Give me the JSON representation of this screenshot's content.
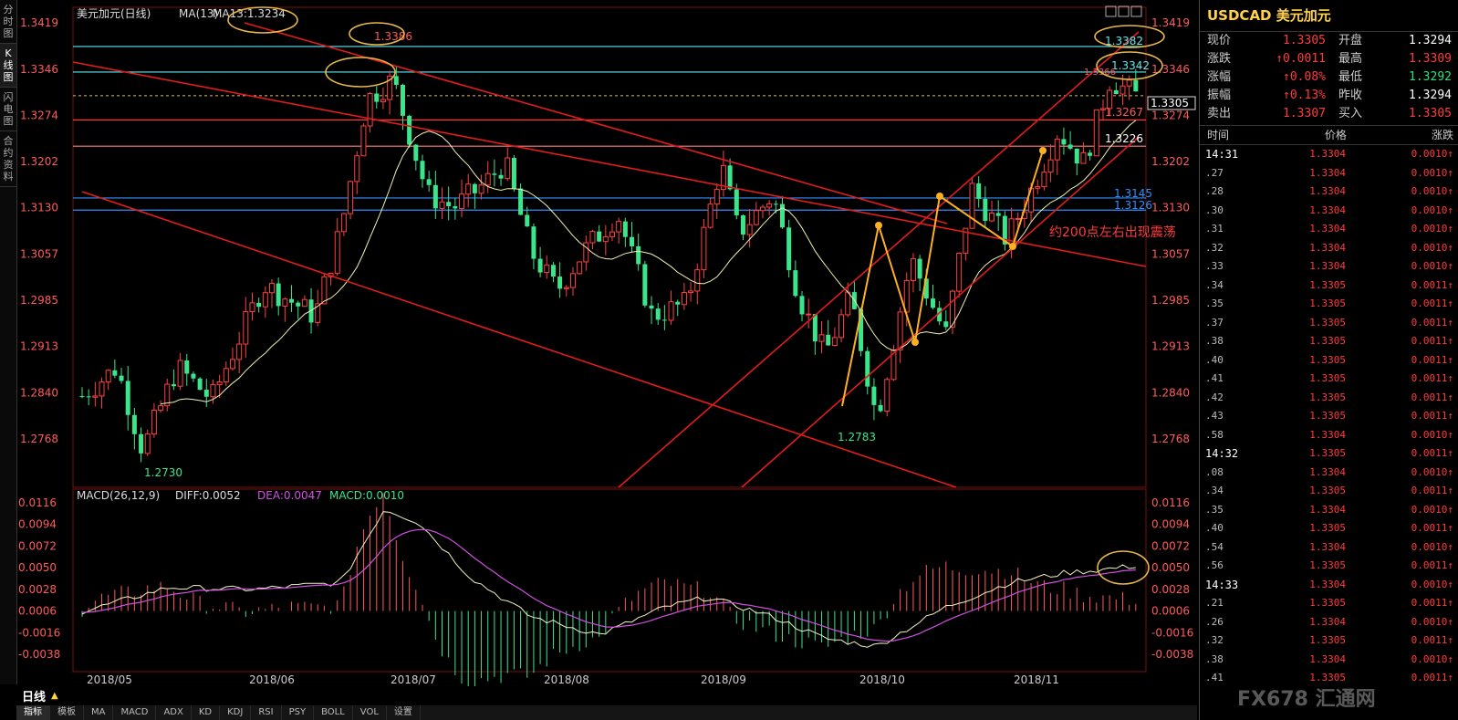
{
  "left_tabs": [
    "分时图",
    "K线图",
    "闪电图",
    "合约资料"
  ],
  "header": {
    "symbol_name": "美元加元(日线)",
    "ma_label": "MA(13)",
    "ma_value": "MA13:1.3234"
  },
  "price_axis": [
    "1.3419",
    "1.3346",
    "1.3274",
    "1.3202",
    "1.3130",
    "1.3057",
    "1.2985",
    "1.2913",
    "1.2840",
    "1.2768"
  ],
  "price_tags": {
    "current": "1.3305",
    "red_1": "1.3267",
    "red_2": "1.3226",
    "blue_1": "1.3145",
    "blue_2": "1.3126",
    "cyan_1": "1.3342",
    "cyan_2": "1.3382",
    "high_label": "1.3386",
    "low_label_1": "1.2730",
    "low_label_2": "1.2783",
    "top_small": "1.3366"
  },
  "annotation": "约200点左右出现震荡",
  "macd": {
    "label": "MACD(26,12,9)",
    "diff": "DIFF:0.0052",
    "dea": "DEA:0.0047",
    "macd": "MACD:0.0010",
    "axis": [
      "0.0116",
      "0.0094",
      "0.0072",
      "0.0050",
      "0.0028",
      "0.0006",
      "-0.0016",
      "-0.0038"
    ]
  },
  "time_axis": [
    "2018/05",
    "2018/06",
    "2018/07",
    "2018/08",
    "2018/09",
    "2018/10",
    "2018/11"
  ],
  "period": "日线",
  "tool_tabs": [
    "指标",
    "模板",
    "MA",
    "MACD",
    "ADX",
    "KD",
    "KDJ",
    "RSI",
    "PSY",
    "BOLL",
    "VOL",
    "设置"
  ],
  "quote": {
    "title": "USDCAD 美元加元",
    "rows": [
      {
        "l1": "现价",
        "v1": "1.3305",
        "c1": "red",
        "l2": "开盘",
        "v2": "1.3294",
        "c2": "white"
      },
      {
        "l1": "涨跌",
        "v1": "↑0.0011",
        "c1": "red",
        "l2": "最高",
        "v2": "1.3309",
        "c2": "red"
      },
      {
        "l1": "涨幅",
        "v1": "↑0.08%",
        "c1": "red",
        "l2": "最低",
        "v2": "1.3292",
        "c2": "green"
      },
      {
        "l1": "振幅",
        "v1": "↑0.13%",
        "c1": "red",
        "l2": "昨收",
        "v2": "1.3294",
        "c2": "white"
      },
      {
        "l1": "卖出",
        "v1": "1.3307",
        "c1": "red",
        "l2": "买入",
        "v2": "1.3305",
        "c2": "red"
      }
    ],
    "tick_header": [
      "时间",
      "价格",
      "涨跌"
    ],
    "ticks": [
      {
        "t": "14:31",
        "p": "1.3304",
        "c": "0.0010↑",
        "big": true
      },
      {
        "t": ".27",
        "p": "1.3304",
        "c": "0.0010↑"
      },
      {
        "t": ".28",
        "p": "1.3304",
        "c": "0.0010↑"
      },
      {
        "t": ".30",
        "p": "1.3304",
        "c": "0.0010↑"
      },
      {
        "t": ".31",
        "p": "1.3304",
        "c": "0.0010↑"
      },
      {
        "t": ".32",
        "p": "1.3304",
        "c": "0.0010↑"
      },
      {
        "t": ".33",
        "p": "1.3304",
        "c": "0.0010↑"
      },
      {
        "t": ".34",
        "p": "1.3305",
        "c": "0.0011↑"
      },
      {
        "t": ".35",
        "p": "1.3305",
        "c": "0.0011↑"
      },
      {
        "t": ".37",
        "p": "1.3305",
        "c": "0.0011↑"
      },
      {
        "t": ".38",
        "p": "1.3305",
        "c": "0.0011↑"
      },
      {
        "t": ".40",
        "p": "1.3305",
        "c": "0.0011↑"
      },
      {
        "t": ".41",
        "p": "1.3305",
        "c": "0.0011↑"
      },
      {
        "t": ".42",
        "p": "1.3305",
        "c": "0.0011↑"
      },
      {
        "t": ".43",
        "p": "1.3305",
        "c": "0.0011↑"
      },
      {
        "t": ".58",
        "p": "1.3304",
        "c": "0.0010↑"
      },
      {
        "t": "14:32",
        "p": "1.3305",
        "c": "0.0011↑",
        "big": true
      },
      {
        "t": ".08",
        "p": "1.3304",
        "c": "0.0010↑"
      },
      {
        "t": ".34",
        "p": "1.3305",
        "c": "0.0011↑"
      },
      {
        "t": ".35",
        "p": "1.3304",
        "c": "0.0010↑"
      },
      {
        "t": ".40",
        "p": "1.3305",
        "c": "0.0011↑"
      },
      {
        "t": ".54",
        "p": "1.3304",
        "c": "0.0010↑"
      },
      {
        "t": ".56",
        "p": "1.3305",
        "c": "0.0011↑"
      },
      {
        "t": "14:33",
        "p": "1.3304",
        "c": "0.0010↑",
        "big": true
      },
      {
        "t": ".21",
        "p": "1.3305",
        "c": "0.0011↑"
      },
      {
        "t": ".26",
        "p": "1.3304",
        "c": "0.0010↑"
      },
      {
        "t": ".32",
        "p": "1.3305",
        "c": "0.0011↑"
      },
      {
        "t": ".38",
        "p": "1.3304",
        "c": "0.0010↑"
      },
      {
        "t": ".41",
        "p": "1.3305",
        "c": "0.0011↑"
      }
    ]
  },
  "watermark": "FX678 汇通网",
  "colors": {
    "up": "#ff3b3b",
    "down": "#2ee07a",
    "cyan": "#5ee9f2",
    "blue": "#2f8fff",
    "gold": "#e8b84a",
    "ma": "#f2f2b0",
    "dea": "#d050e0"
  }
}
